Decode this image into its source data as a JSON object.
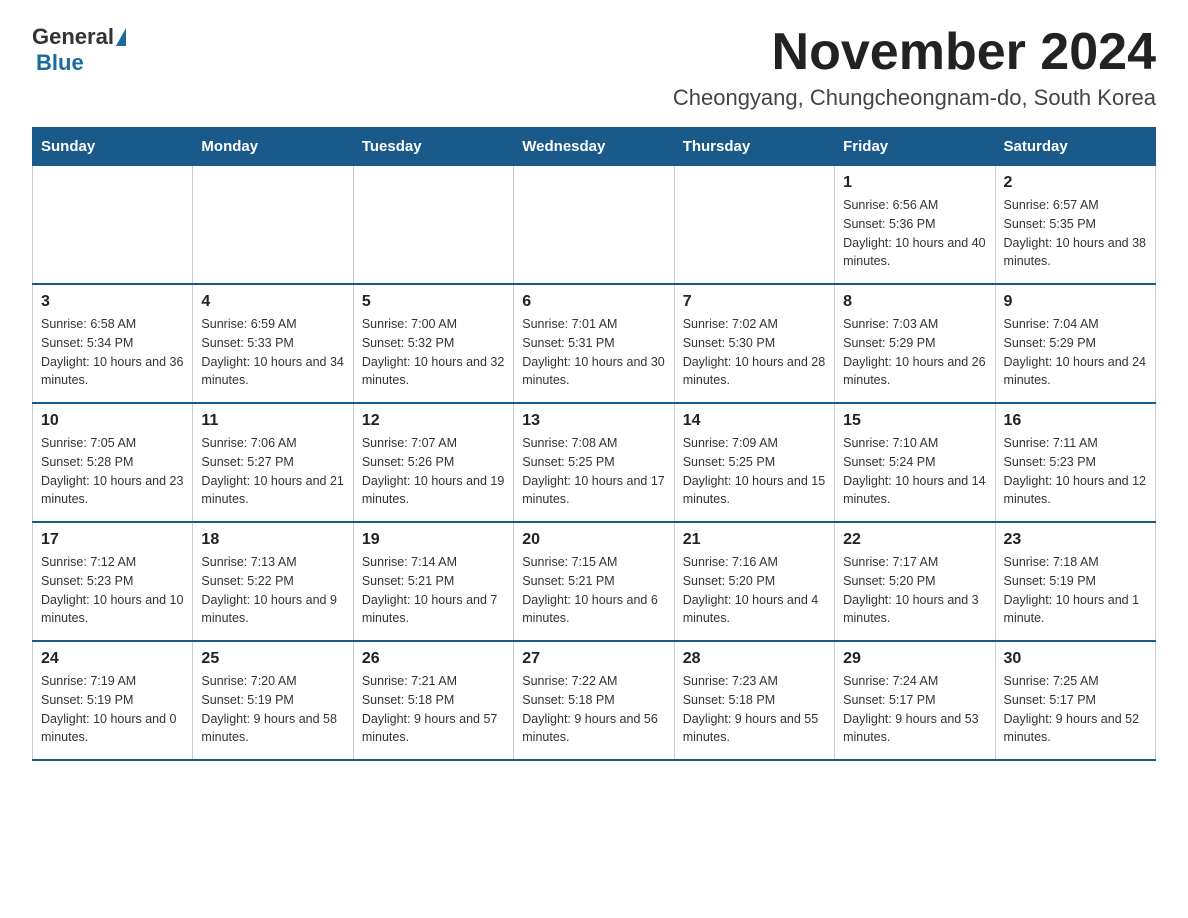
{
  "header": {
    "logo_general": "General",
    "logo_blue": "Blue",
    "title": "November 2024",
    "subtitle": "Cheongyang, Chungcheongnam-do, South Korea"
  },
  "days_of_week": [
    "Sunday",
    "Monday",
    "Tuesday",
    "Wednesday",
    "Thursday",
    "Friday",
    "Saturday"
  ],
  "weeks": [
    [
      {
        "day": "",
        "info": ""
      },
      {
        "day": "",
        "info": ""
      },
      {
        "day": "",
        "info": ""
      },
      {
        "day": "",
        "info": ""
      },
      {
        "day": "",
        "info": ""
      },
      {
        "day": "1",
        "info": "Sunrise: 6:56 AM\nSunset: 5:36 PM\nDaylight: 10 hours and 40 minutes."
      },
      {
        "day": "2",
        "info": "Sunrise: 6:57 AM\nSunset: 5:35 PM\nDaylight: 10 hours and 38 minutes."
      }
    ],
    [
      {
        "day": "3",
        "info": "Sunrise: 6:58 AM\nSunset: 5:34 PM\nDaylight: 10 hours and 36 minutes."
      },
      {
        "day": "4",
        "info": "Sunrise: 6:59 AM\nSunset: 5:33 PM\nDaylight: 10 hours and 34 minutes."
      },
      {
        "day": "5",
        "info": "Sunrise: 7:00 AM\nSunset: 5:32 PM\nDaylight: 10 hours and 32 minutes."
      },
      {
        "day": "6",
        "info": "Sunrise: 7:01 AM\nSunset: 5:31 PM\nDaylight: 10 hours and 30 minutes."
      },
      {
        "day": "7",
        "info": "Sunrise: 7:02 AM\nSunset: 5:30 PM\nDaylight: 10 hours and 28 minutes."
      },
      {
        "day": "8",
        "info": "Sunrise: 7:03 AM\nSunset: 5:29 PM\nDaylight: 10 hours and 26 minutes."
      },
      {
        "day": "9",
        "info": "Sunrise: 7:04 AM\nSunset: 5:29 PM\nDaylight: 10 hours and 24 minutes."
      }
    ],
    [
      {
        "day": "10",
        "info": "Sunrise: 7:05 AM\nSunset: 5:28 PM\nDaylight: 10 hours and 23 minutes."
      },
      {
        "day": "11",
        "info": "Sunrise: 7:06 AM\nSunset: 5:27 PM\nDaylight: 10 hours and 21 minutes."
      },
      {
        "day": "12",
        "info": "Sunrise: 7:07 AM\nSunset: 5:26 PM\nDaylight: 10 hours and 19 minutes."
      },
      {
        "day": "13",
        "info": "Sunrise: 7:08 AM\nSunset: 5:25 PM\nDaylight: 10 hours and 17 minutes."
      },
      {
        "day": "14",
        "info": "Sunrise: 7:09 AM\nSunset: 5:25 PM\nDaylight: 10 hours and 15 minutes."
      },
      {
        "day": "15",
        "info": "Sunrise: 7:10 AM\nSunset: 5:24 PM\nDaylight: 10 hours and 14 minutes."
      },
      {
        "day": "16",
        "info": "Sunrise: 7:11 AM\nSunset: 5:23 PM\nDaylight: 10 hours and 12 minutes."
      }
    ],
    [
      {
        "day": "17",
        "info": "Sunrise: 7:12 AM\nSunset: 5:23 PM\nDaylight: 10 hours and 10 minutes."
      },
      {
        "day": "18",
        "info": "Sunrise: 7:13 AM\nSunset: 5:22 PM\nDaylight: 10 hours and 9 minutes."
      },
      {
        "day": "19",
        "info": "Sunrise: 7:14 AM\nSunset: 5:21 PM\nDaylight: 10 hours and 7 minutes."
      },
      {
        "day": "20",
        "info": "Sunrise: 7:15 AM\nSunset: 5:21 PM\nDaylight: 10 hours and 6 minutes."
      },
      {
        "day": "21",
        "info": "Sunrise: 7:16 AM\nSunset: 5:20 PM\nDaylight: 10 hours and 4 minutes."
      },
      {
        "day": "22",
        "info": "Sunrise: 7:17 AM\nSunset: 5:20 PM\nDaylight: 10 hours and 3 minutes."
      },
      {
        "day": "23",
        "info": "Sunrise: 7:18 AM\nSunset: 5:19 PM\nDaylight: 10 hours and 1 minute."
      }
    ],
    [
      {
        "day": "24",
        "info": "Sunrise: 7:19 AM\nSunset: 5:19 PM\nDaylight: 10 hours and 0 minutes."
      },
      {
        "day": "25",
        "info": "Sunrise: 7:20 AM\nSunset: 5:19 PM\nDaylight: 9 hours and 58 minutes."
      },
      {
        "day": "26",
        "info": "Sunrise: 7:21 AM\nSunset: 5:18 PM\nDaylight: 9 hours and 57 minutes."
      },
      {
        "day": "27",
        "info": "Sunrise: 7:22 AM\nSunset: 5:18 PM\nDaylight: 9 hours and 56 minutes."
      },
      {
        "day": "28",
        "info": "Sunrise: 7:23 AM\nSunset: 5:18 PM\nDaylight: 9 hours and 55 minutes."
      },
      {
        "day": "29",
        "info": "Sunrise: 7:24 AM\nSunset: 5:17 PM\nDaylight: 9 hours and 53 minutes."
      },
      {
        "day": "30",
        "info": "Sunrise: 7:25 AM\nSunset: 5:17 PM\nDaylight: 9 hours and 52 minutes."
      }
    ]
  ]
}
